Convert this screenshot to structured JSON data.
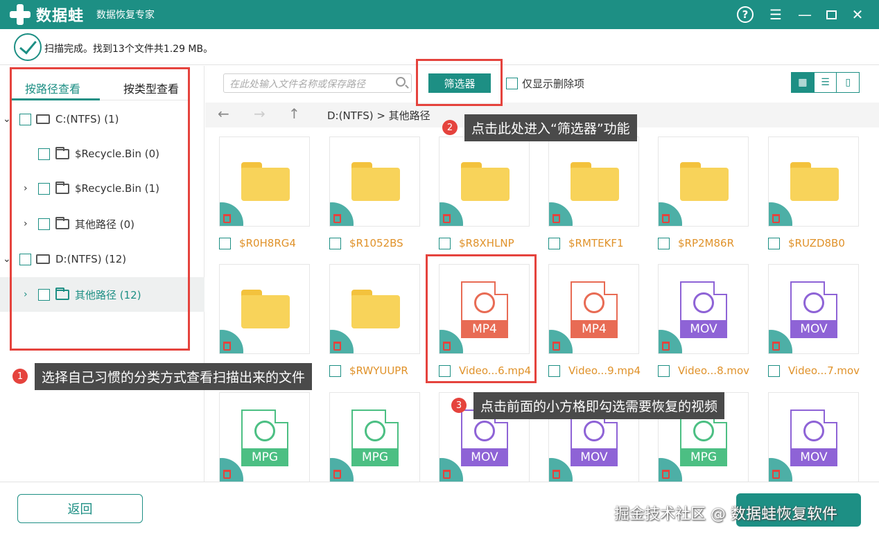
{
  "app": {
    "brand": "数据蛙",
    "subtitle": "数据恢复专家"
  },
  "window_controls": [
    "help-icon",
    "menu-icon",
    "minimize-icon",
    "maximize-icon",
    "close-icon"
  ],
  "status": {
    "text": "扫描完成。找到13个文件共1.29 MB。"
  },
  "left": {
    "tabs": [
      {
        "label": "按路径查看",
        "active": true
      },
      {
        "label": "按类型查看",
        "active": false
      }
    ],
    "tree": [
      {
        "label": "C:(NTFS) (1)"
      },
      {
        "label": "$Recycle.Bin (0)"
      },
      {
        "label": "$Recycle.Bin (1)"
      },
      {
        "label": "其他路径 (0)"
      },
      {
        "label": "D:(NTFS) (12)"
      },
      {
        "label": "其他路径 (12)"
      }
    ]
  },
  "toolbar": {
    "search_placeholder": "在此处输入文件名称或保存路径",
    "filter_label": "筛选器",
    "only_deleted_label": "仅显示删除项"
  },
  "nav": {
    "breadcrumb": "D:(NTFS) > 其他路径"
  },
  "files": [
    {
      "name": "$R0H8RG4",
      "type": "folder"
    },
    {
      "name": "$R1052BS",
      "type": "folder"
    },
    {
      "name": "$R8XHLNP",
      "type": "folder"
    },
    {
      "name": "$RMTEKF1",
      "type": "folder"
    },
    {
      "name": "$RP2M86R",
      "type": "folder"
    },
    {
      "name": "$RUZD8B0",
      "type": "folder"
    },
    {
      "name": "",
      "type": "folder"
    },
    {
      "name": "$RWYUUPR",
      "type": "folder"
    },
    {
      "name": "Video...6.mp4",
      "type": "MP4"
    },
    {
      "name": "Video...9.mp4",
      "type": "MP4"
    },
    {
      "name": "Video...8.mov",
      "type": "MOV"
    },
    {
      "name": "Video...7.mov",
      "type": "MOV"
    },
    {
      "name": "",
      "type": "MPG"
    },
    {
      "name": "",
      "type": "MPG"
    },
    {
      "name": "",
      "type": "MOV"
    },
    {
      "name": "",
      "type": "MOV"
    },
    {
      "name": "",
      "type": "MPG"
    },
    {
      "name": "",
      "type": "MOV"
    }
  ],
  "callouts": [
    {
      "num": "1",
      "text": "选择自己习惯的分类方式查看扫描出来的文件"
    },
    {
      "num": "2",
      "text": "点击此处进入“筛选器”功能"
    },
    {
      "num": "3",
      "text": "点击前面的小方格即勾选需要恢复的视频"
    }
  ],
  "bottom": {
    "back_label": "返回"
  },
  "watermark": "掘金技术社区 @ 数据蛙恢复软件",
  "colors": {
    "brand": "#1d8f84",
    "annotation": "#e5433d",
    "folder": "#f8d35a",
    "mp4": "#e86b54",
    "mov": "#8e63d6",
    "mpg": "#4cbf83"
  }
}
